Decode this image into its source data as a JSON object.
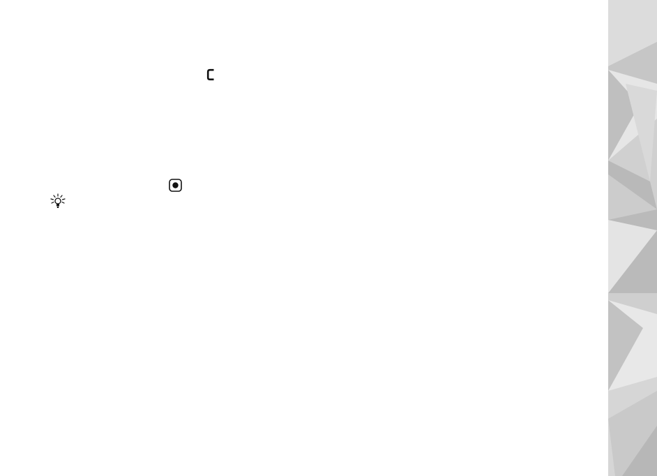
{
  "page": {
    "background_color": "#ffffff"
  },
  "icons": {
    "clear_key": "clear-key-icon",
    "navi_key": "navi-key-center-icon",
    "tip": "lightbulb-tip-icon"
  },
  "decoration": {
    "side_strip_colors": [
      "#e4e4e4",
      "#d6d6d6",
      "#c8c8c8",
      "#bdbdbd",
      "#b0b0b0",
      "#f0f0f0"
    ]
  }
}
